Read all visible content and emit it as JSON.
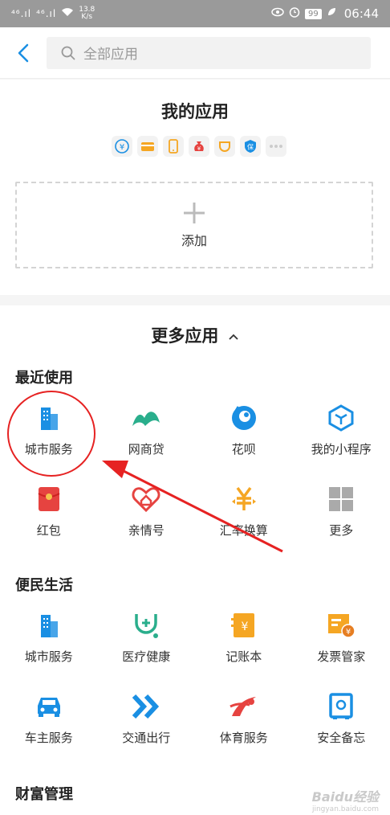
{
  "status_bar": {
    "signal1": "⁴⁶.ıl",
    "signal2": "⁴⁶.ıl",
    "speed_value": "13.8",
    "speed_unit": "K/s",
    "battery": "99",
    "time": "06:44"
  },
  "header": {
    "search_placeholder": "全部应用"
  },
  "my_apps": {
    "title": "我的应用",
    "add_label": "添加"
  },
  "more_apps": {
    "title": "更多应用",
    "sections": [
      {
        "title": "最近使用",
        "items": [
          {
            "label": "城市服务"
          },
          {
            "label": "网商贷"
          },
          {
            "label": "花呗"
          },
          {
            "label": "我的小程序"
          },
          {
            "label": "红包"
          },
          {
            "label": "亲情号"
          },
          {
            "label": "汇率换算"
          },
          {
            "label": "更多"
          }
        ]
      },
      {
        "title": "便民生活",
        "items": [
          {
            "label": "城市服务"
          },
          {
            "label": "医疗健康"
          },
          {
            "label": "记账本"
          },
          {
            "label": "发票管家"
          },
          {
            "label": "车主服务"
          },
          {
            "label": "交通出行"
          },
          {
            "label": "体育服务"
          },
          {
            "label": "安全备忘"
          }
        ]
      },
      {
        "title": "财富管理"
      }
    ]
  },
  "watermark": {
    "text": "Baidu经验",
    "sub": "jingyan.baidu.com"
  },
  "colors": {
    "accent_blue": "#1a8fe3",
    "green": "#2aae8c",
    "orange": "#f5a623",
    "red": "#e64340",
    "annotation_red": "#e62222"
  }
}
